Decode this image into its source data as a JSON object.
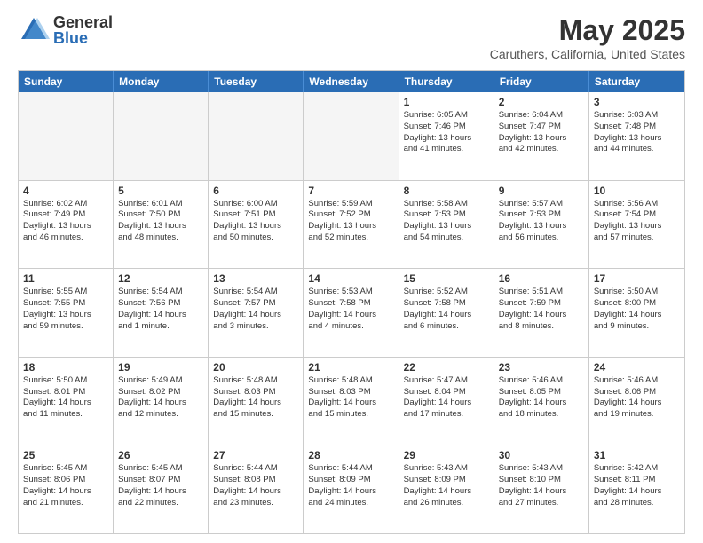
{
  "logo": {
    "general": "General",
    "blue": "Blue"
  },
  "header": {
    "title": "May 2025",
    "location": "Caruthers, California, United States"
  },
  "weekdays": [
    "Sunday",
    "Monday",
    "Tuesday",
    "Wednesday",
    "Thursday",
    "Friday",
    "Saturday"
  ],
  "rows": [
    [
      {
        "day": "",
        "lines": [],
        "empty": true
      },
      {
        "day": "",
        "lines": [],
        "empty": true
      },
      {
        "day": "",
        "lines": [],
        "empty": true
      },
      {
        "day": "",
        "lines": [],
        "empty": true
      },
      {
        "day": "1",
        "lines": [
          "Sunrise: 6:05 AM",
          "Sunset: 7:46 PM",
          "Daylight: 13 hours",
          "and 41 minutes."
        ]
      },
      {
        "day": "2",
        "lines": [
          "Sunrise: 6:04 AM",
          "Sunset: 7:47 PM",
          "Daylight: 13 hours",
          "and 42 minutes."
        ]
      },
      {
        "day": "3",
        "lines": [
          "Sunrise: 6:03 AM",
          "Sunset: 7:48 PM",
          "Daylight: 13 hours",
          "and 44 minutes."
        ]
      }
    ],
    [
      {
        "day": "4",
        "lines": [
          "Sunrise: 6:02 AM",
          "Sunset: 7:49 PM",
          "Daylight: 13 hours",
          "and 46 minutes."
        ]
      },
      {
        "day": "5",
        "lines": [
          "Sunrise: 6:01 AM",
          "Sunset: 7:50 PM",
          "Daylight: 13 hours",
          "and 48 minutes."
        ]
      },
      {
        "day": "6",
        "lines": [
          "Sunrise: 6:00 AM",
          "Sunset: 7:51 PM",
          "Daylight: 13 hours",
          "and 50 minutes."
        ]
      },
      {
        "day": "7",
        "lines": [
          "Sunrise: 5:59 AM",
          "Sunset: 7:52 PM",
          "Daylight: 13 hours",
          "and 52 minutes."
        ]
      },
      {
        "day": "8",
        "lines": [
          "Sunrise: 5:58 AM",
          "Sunset: 7:53 PM",
          "Daylight: 13 hours",
          "and 54 minutes."
        ]
      },
      {
        "day": "9",
        "lines": [
          "Sunrise: 5:57 AM",
          "Sunset: 7:53 PM",
          "Daylight: 13 hours",
          "and 56 minutes."
        ]
      },
      {
        "day": "10",
        "lines": [
          "Sunrise: 5:56 AM",
          "Sunset: 7:54 PM",
          "Daylight: 13 hours",
          "and 57 minutes."
        ]
      }
    ],
    [
      {
        "day": "11",
        "lines": [
          "Sunrise: 5:55 AM",
          "Sunset: 7:55 PM",
          "Daylight: 13 hours",
          "and 59 minutes."
        ]
      },
      {
        "day": "12",
        "lines": [
          "Sunrise: 5:54 AM",
          "Sunset: 7:56 PM",
          "Daylight: 14 hours",
          "and 1 minute."
        ]
      },
      {
        "day": "13",
        "lines": [
          "Sunrise: 5:54 AM",
          "Sunset: 7:57 PM",
          "Daylight: 14 hours",
          "and 3 minutes."
        ]
      },
      {
        "day": "14",
        "lines": [
          "Sunrise: 5:53 AM",
          "Sunset: 7:58 PM",
          "Daylight: 14 hours",
          "and 4 minutes."
        ]
      },
      {
        "day": "15",
        "lines": [
          "Sunrise: 5:52 AM",
          "Sunset: 7:58 PM",
          "Daylight: 14 hours",
          "and 6 minutes."
        ]
      },
      {
        "day": "16",
        "lines": [
          "Sunrise: 5:51 AM",
          "Sunset: 7:59 PM",
          "Daylight: 14 hours",
          "and 8 minutes."
        ]
      },
      {
        "day": "17",
        "lines": [
          "Sunrise: 5:50 AM",
          "Sunset: 8:00 PM",
          "Daylight: 14 hours",
          "and 9 minutes."
        ]
      }
    ],
    [
      {
        "day": "18",
        "lines": [
          "Sunrise: 5:50 AM",
          "Sunset: 8:01 PM",
          "Daylight: 14 hours",
          "and 11 minutes."
        ]
      },
      {
        "day": "19",
        "lines": [
          "Sunrise: 5:49 AM",
          "Sunset: 8:02 PM",
          "Daylight: 14 hours",
          "and 12 minutes."
        ]
      },
      {
        "day": "20",
        "lines": [
          "Sunrise: 5:48 AM",
          "Sunset: 8:03 PM",
          "Daylight: 14 hours",
          "and 15 minutes."
        ]
      },
      {
        "day": "21",
        "lines": [
          "Sunrise: 5:48 AM",
          "Sunset: 8:03 PM",
          "Daylight: 14 hours",
          "and 15 minutes."
        ]
      },
      {
        "day": "22",
        "lines": [
          "Sunrise: 5:47 AM",
          "Sunset: 8:04 PM",
          "Daylight: 14 hours",
          "and 17 minutes."
        ]
      },
      {
        "day": "23",
        "lines": [
          "Sunrise: 5:46 AM",
          "Sunset: 8:05 PM",
          "Daylight: 14 hours",
          "and 18 minutes."
        ]
      },
      {
        "day": "24",
        "lines": [
          "Sunrise: 5:46 AM",
          "Sunset: 8:06 PM",
          "Daylight: 14 hours",
          "and 19 minutes."
        ]
      }
    ],
    [
      {
        "day": "25",
        "lines": [
          "Sunrise: 5:45 AM",
          "Sunset: 8:06 PM",
          "Daylight: 14 hours",
          "and 21 minutes."
        ]
      },
      {
        "day": "26",
        "lines": [
          "Sunrise: 5:45 AM",
          "Sunset: 8:07 PM",
          "Daylight: 14 hours",
          "and 22 minutes."
        ]
      },
      {
        "day": "27",
        "lines": [
          "Sunrise: 5:44 AM",
          "Sunset: 8:08 PM",
          "Daylight: 14 hours",
          "and 23 minutes."
        ]
      },
      {
        "day": "28",
        "lines": [
          "Sunrise: 5:44 AM",
          "Sunset: 8:09 PM",
          "Daylight: 14 hours",
          "and 24 minutes."
        ]
      },
      {
        "day": "29",
        "lines": [
          "Sunrise: 5:43 AM",
          "Sunset: 8:09 PM",
          "Daylight: 14 hours",
          "and 26 minutes."
        ]
      },
      {
        "day": "30",
        "lines": [
          "Sunrise: 5:43 AM",
          "Sunset: 8:10 PM",
          "Daylight: 14 hours",
          "and 27 minutes."
        ]
      },
      {
        "day": "31",
        "lines": [
          "Sunrise: 5:42 AM",
          "Sunset: 8:11 PM",
          "Daylight: 14 hours",
          "and 28 minutes."
        ]
      }
    ]
  ]
}
